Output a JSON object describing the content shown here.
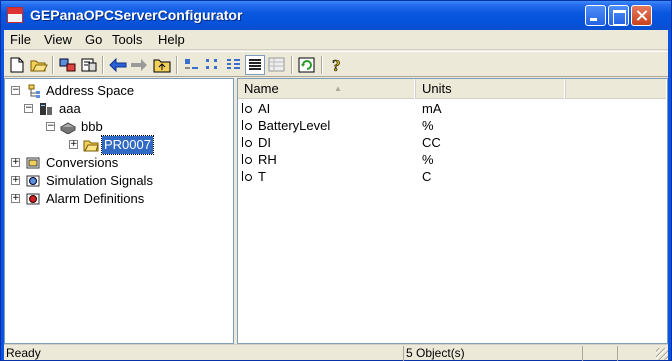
{
  "window": {
    "title": "GEPanaOPCServerConfigurator",
    "icon": "app-icon",
    "accent": "#0a54e3"
  },
  "menu": [
    "File",
    "View",
    "Go",
    "Tools",
    "Help"
  ],
  "toolbar": {
    "buttons": [
      "new-icon",
      "open-icon",
      "connect-icon",
      "properties-icon",
      "back-arrow-icon",
      "forward-arrow-icon",
      "up-folder-icon",
      "large-icons-view-icon",
      "small-icons-view-icon",
      "list-view-icon",
      "details-view-icon",
      "grid-view-icon",
      "refresh-icon",
      "help-icon"
    ]
  },
  "tree": {
    "items": [
      {
        "label": "Address Space",
        "expander": "−",
        "icon": "address-space-icon"
      },
      {
        "label": "aaa",
        "expander": "−",
        "icon": "server-icon"
      },
      {
        "label": "bbb",
        "expander": "−",
        "icon": "device-icon"
      },
      {
        "label": "PR0007",
        "expander": "+",
        "icon": "folder-icon",
        "selected": true
      },
      {
        "label": "Conversions",
        "expander": "+",
        "icon": "conversions-icon"
      },
      {
        "label": "Simulation Signals",
        "expander": "+",
        "icon": "simulation-icon"
      },
      {
        "label": "Alarm Definitions",
        "expander": "+",
        "icon": "alarm-icon"
      }
    ]
  },
  "list": {
    "columns": [
      "Name",
      "Units"
    ],
    "sort_indicator": "▲",
    "rows": [
      {
        "name": "AI",
        "units": "mA",
        "icon": "tag-icon"
      },
      {
        "name": "BatteryLevel",
        "units": "%",
        "icon": "tag-icon"
      },
      {
        "name": "DI",
        "units": "CC",
        "icon": "tag-icon"
      },
      {
        "name": "RH",
        "units": "%",
        "icon": "tag-icon"
      },
      {
        "name": "T",
        "units": "C",
        "icon": "tag-icon"
      }
    ]
  },
  "status": {
    "left": "Ready",
    "count": "5 Object(s)"
  }
}
